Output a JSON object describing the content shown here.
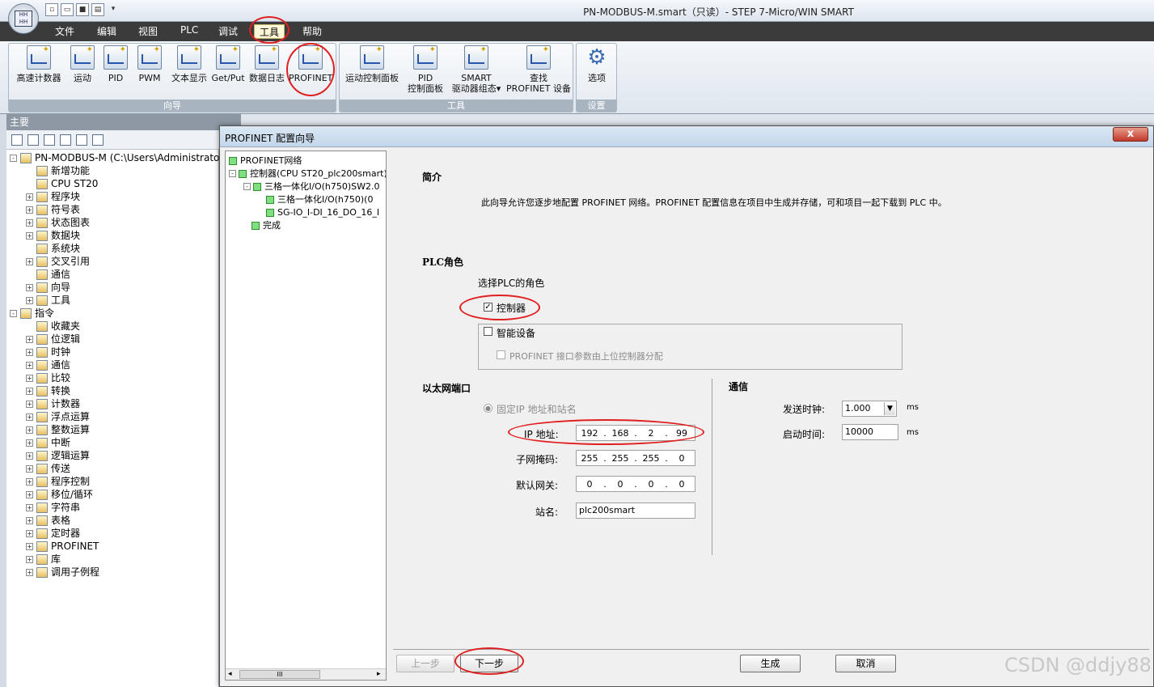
{
  "window": {
    "title": "PN-MODBUS-M.smart（只读）- STEP 7-Micro/WIN SMART"
  },
  "menu": [
    "文件",
    "编辑",
    "视图",
    "PLC",
    "调试",
    "工具",
    "帮助"
  ],
  "ribbon": {
    "wizard_group": {
      "label": "向导",
      "buttons": [
        "高速计数器",
        "运动",
        "PID",
        "PWM",
        "文本显示",
        "Get/Put",
        "数据日志",
        "PROFINET"
      ]
    },
    "tools_group": {
      "label": "工具",
      "buttons": [
        {
          "line1": "运动控制面板",
          "line2": ""
        },
        {
          "line1": "PID",
          "line2": "控制面板"
        },
        {
          "line1": "SMART",
          "line2": "驱动器组态▾"
        },
        {
          "line1": "查找",
          "line2": "PROFINET 设备"
        }
      ]
    },
    "settings_group": {
      "label": "设置",
      "buttons": [
        "选项"
      ]
    }
  },
  "left_panel": {
    "header": "主要",
    "tree": [
      {
        "label": "PN-MODBUS-M (C:\\Users\\Administrator\\Desk",
        "level": 0,
        "expander": "-"
      },
      {
        "label": "新增功能",
        "level": 1,
        "expander": ""
      },
      {
        "label": "CPU ST20",
        "level": 1,
        "expander": ""
      },
      {
        "label": "程序块",
        "level": 1,
        "expander": "+"
      },
      {
        "label": "符号表",
        "level": 1,
        "expander": "+"
      },
      {
        "label": "状态图表",
        "level": 1,
        "expander": "+"
      },
      {
        "label": "数据块",
        "level": 1,
        "expander": "+"
      },
      {
        "label": "系统块",
        "level": 1,
        "expander": ""
      },
      {
        "label": "交叉引用",
        "level": 1,
        "expander": "+"
      },
      {
        "label": "通信",
        "level": 1,
        "expander": ""
      },
      {
        "label": "向导",
        "level": 1,
        "expander": "+"
      },
      {
        "label": "工具",
        "level": 1,
        "expander": "+"
      },
      {
        "label": "指令",
        "level": 0,
        "expander": "-"
      },
      {
        "label": "收藏夹",
        "level": 1,
        "expander": ""
      },
      {
        "label": "位逻辑",
        "level": 1,
        "expander": "+"
      },
      {
        "label": "时钟",
        "level": 1,
        "expander": "+"
      },
      {
        "label": "通信",
        "level": 1,
        "expander": "+"
      },
      {
        "label": "比较",
        "level": 1,
        "expander": "+"
      },
      {
        "label": "转换",
        "level": 1,
        "expander": "+"
      },
      {
        "label": "计数器",
        "level": 1,
        "expander": "+"
      },
      {
        "label": "浮点运算",
        "level": 1,
        "expander": "+"
      },
      {
        "label": "整数运算",
        "level": 1,
        "expander": "+"
      },
      {
        "label": "中断",
        "level": 1,
        "expander": "+"
      },
      {
        "label": "逻辑运算",
        "level": 1,
        "expander": "+"
      },
      {
        "label": "传送",
        "level": 1,
        "expander": "+"
      },
      {
        "label": "程序控制",
        "level": 1,
        "expander": "+"
      },
      {
        "label": "移位/循环",
        "level": 1,
        "expander": "+"
      },
      {
        "label": "字符串",
        "level": 1,
        "expander": "+"
      },
      {
        "label": "表格",
        "level": 1,
        "expander": "+"
      },
      {
        "label": "定时器",
        "level": 1,
        "expander": "+"
      },
      {
        "label": "PROFINET",
        "level": 1,
        "expander": "+"
      },
      {
        "label": "库",
        "level": 1,
        "expander": "+"
      },
      {
        "label": "调用子例程",
        "level": 1,
        "expander": "+"
      }
    ]
  },
  "dialog": {
    "title": "PROFINET 配置向导",
    "close": "x",
    "nav": [
      {
        "label": "PROFINET网络",
        "level": 0,
        "expander": ""
      },
      {
        "label": "控制器(CPU ST20_plc200smart)",
        "level": 0,
        "expander": "-"
      },
      {
        "label": "三格一体化I/O(h750)SW2.0",
        "level": 1,
        "expander": "-"
      },
      {
        "label": "三格一体化I/O(h750)(0",
        "level": 2,
        "expander": ""
      },
      {
        "label": "SG-IO_I-DI_16_DO_16_I",
        "level": 2,
        "expander": ""
      },
      {
        "label": "完成",
        "level": 1,
        "expander": ""
      }
    ],
    "nav_scroll_thumb": "III",
    "intro": {
      "heading": "简介",
      "text": "此向导允许您逐步地配置 PROFINET 网络。PROFINET 配置信息在项目中生成并存储，可和项目一起下载到 PLC 中。"
    },
    "plc_role": {
      "heading": "PLC角色",
      "prompt": "选择PLC的角色",
      "controller": {
        "label": "控制器",
        "checked": true
      },
      "smart_device": {
        "label": "智能设备",
        "checked": false
      },
      "smart_device_option": {
        "label": "PROFINET 接口参数由上位控制器分配",
        "checked": false
      }
    },
    "ethernet": {
      "heading": "以太网端口",
      "fixed_ip_label": "固定IP 地址和站名",
      "ip_label": "IP 地址:",
      "ip": [
        "192",
        "168",
        "2",
        "99"
      ],
      "subnet_label": "子网掩码:",
      "subnet": [
        "255",
        "255",
        "255",
        "0"
      ],
      "gateway_label": "默认网关:",
      "gateway": [
        "0",
        "0",
        "0",
        "0"
      ],
      "station_label": "站名:",
      "station": "plc200smart"
    },
    "comm": {
      "heading": "通信",
      "send_clock_label": "发送时钟:",
      "send_clock": "1.000",
      "send_clock_unit": "ms",
      "startup_label": "启动时间:",
      "startup": "10000",
      "startup_unit": "ms"
    },
    "buttons": {
      "prev": "上一步",
      "next": "下一步",
      "generate": "生成",
      "cancel": "取消"
    }
  },
  "watermark": "CSDN @ddjy88"
}
